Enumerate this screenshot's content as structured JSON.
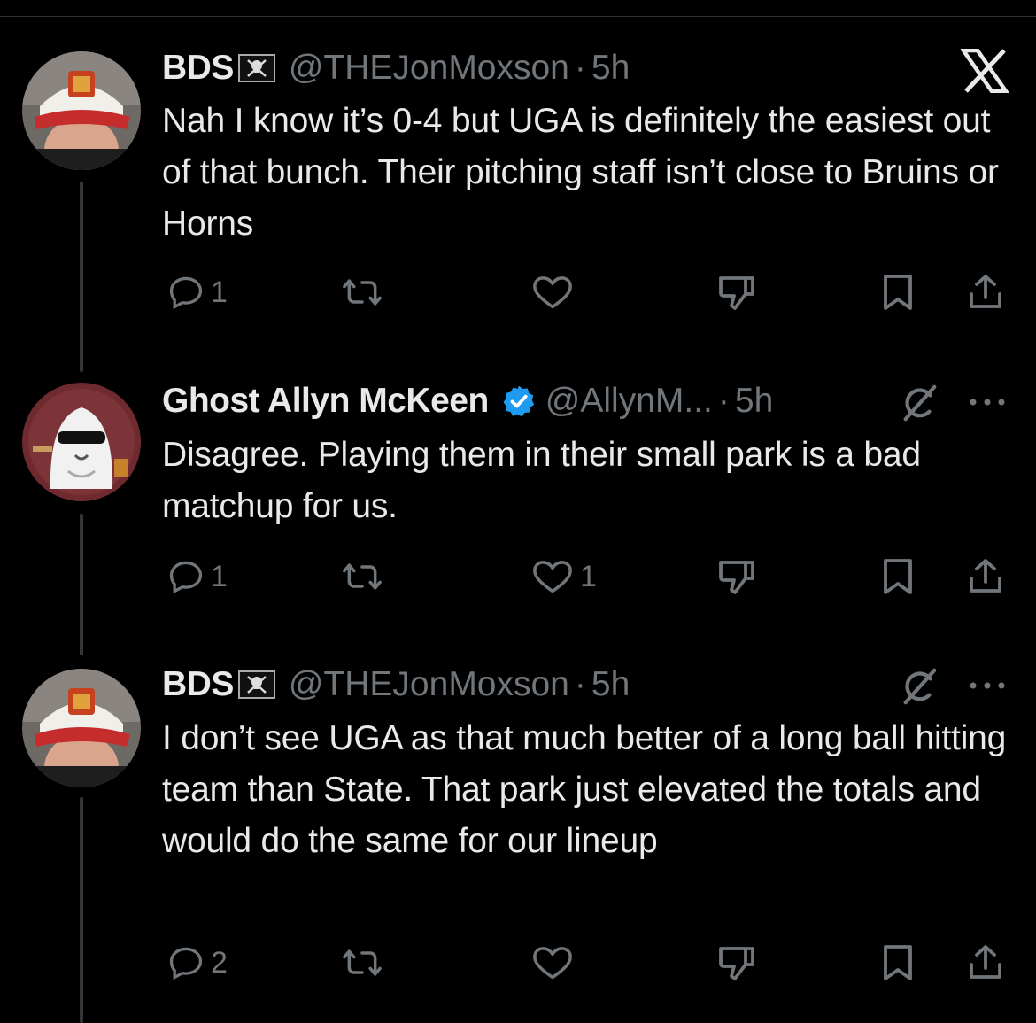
{
  "tweets": [
    {
      "name": "BDS",
      "handle": "@THEJonMoxson",
      "separator": "·",
      "time": "5h",
      "text": "Nah I know it’s 0-4 but UGA is definitely the easiest out of that bunch. Their pitching staff isn’t close to Bruins or Horns",
      "reply_count": "1",
      "retweet_count": "",
      "like_count": "",
      "top_right_icon": "x-logo-icon"
    },
    {
      "name": "Ghost Allyn McKeen",
      "handle": "@AllynM...",
      "separator": "·",
      "time": "5h",
      "text": "Disagree. Playing them in their small park is a bad matchup for us.",
      "reply_count": "1",
      "retweet_count": "",
      "like_count": "1",
      "top_right_icon": "grok-icon"
    },
    {
      "name": "BDS",
      "handle": "@THEJonMoxson",
      "separator": "·",
      "time": "5h",
      "text": "I don’t see UGA as that much better of a long ball hitting team than State. That park just elevated the totals and would do the same for our lineup",
      "reply_count": "2",
      "retweet_count": "",
      "like_count": "",
      "top_right_icon": "grok-icon"
    }
  ],
  "colors": {
    "background": "#000000",
    "text": "#e7e9ea",
    "secondary": "#71767b",
    "verified": "#1d9bf0",
    "thread_line": "#333639"
  }
}
